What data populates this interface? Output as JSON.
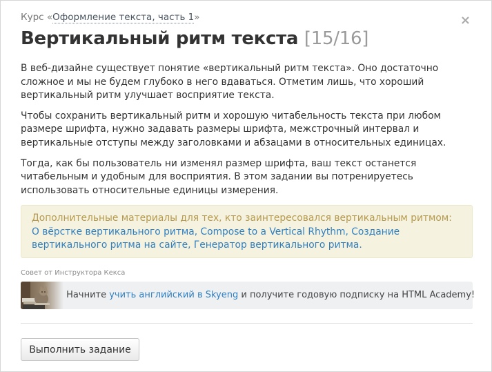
{
  "breadcrumb": {
    "prefix": "Курс «",
    "course_link": "Оформление текста, часть 1",
    "suffix": "»"
  },
  "close_label": "×",
  "title": {
    "text": "Вертикальный ритм текста",
    "progress": "[15/16]"
  },
  "paragraphs": [
    "В веб-дизайне существует понятие «вертикальный ритм текста». Оно достаточно сложное и мы не будем глубоко в него вдаваться. Отметим лишь, что хороший вертикальный ритм улучшает восприятие текста.",
    "Чтобы сохранить вертикальный ритм и хорошую читабельность текста при любом размере шрифта, нужно задавать размеры шрифта, межстрочный интервал и вертикальные отступы между заголовками и абзацами в относительных единицах.",
    "Тогда, как бы пользователь ни изменял размер шрифта, ваш текст останется читабельным и удобным для восприятия. В этом задании вы потренируетесь использовать относительные единицы измерения."
  ],
  "extra": {
    "intro": "Дополнительные материалы для тех, кто заинтересовался вертикальным ритмом:",
    "links": [
      "О вёрстке вертикального ритма",
      "Compose to a Vertical Rhythm",
      "Создание вертикального ритма на сайте",
      "Генератор вертикального ритма"
    ],
    "separator": ", ",
    "end": "."
  },
  "tip": {
    "label": "Совет от Инструктора Кекса",
    "image_icon": "cat-reading-image",
    "text_before": "Начните ",
    "link": "учить английский в Skyeng",
    "text_after": " и получите годовую подписку на HTML Academy!"
  },
  "submit_label": "Выполнить задание",
  "colors": {
    "link": "#2f7fc1",
    "info_bg": "#f5f3e0",
    "info_text": "#b59a4f",
    "ad_bg": "#eef0f2"
  }
}
